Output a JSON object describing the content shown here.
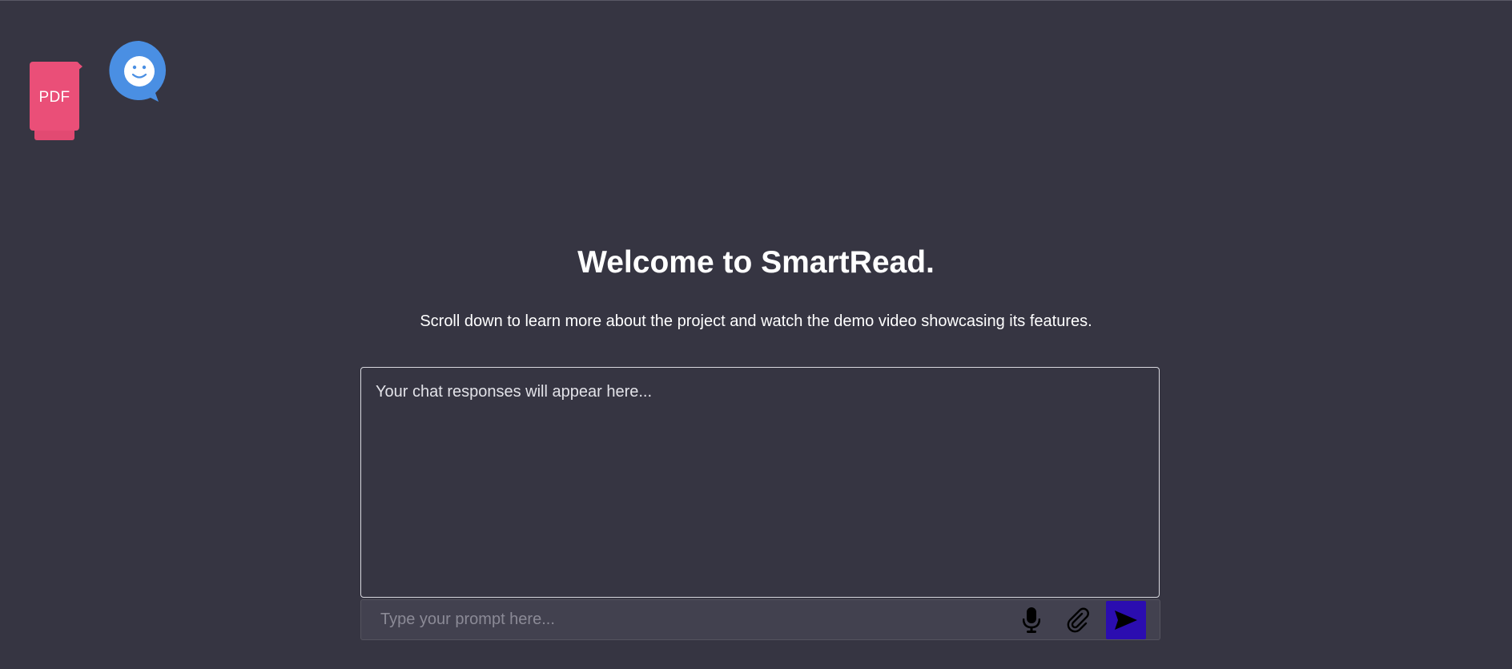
{
  "logo": {
    "pdf_label": "PDF",
    "pdf_icon": "pdf-document-icon",
    "chat_icon": "smiley-chat-bubble-icon",
    "colors": {
      "pdf": "#ea4f78",
      "bubble": "#4a8fe3"
    }
  },
  "hero": {
    "title": "Welcome to SmartRead.",
    "subtitle": "Scroll down to learn more about the project and watch the demo video showcasing its features."
  },
  "chat": {
    "response_placeholder": "Your chat responses will appear here..."
  },
  "prompt": {
    "placeholder": "Type your prompt here...",
    "value": "",
    "mic_icon": "microphone-icon",
    "attach_icon": "paperclip-icon",
    "send_icon": "send-arrow-icon",
    "send_color": "#2b0db0"
  },
  "theme": {
    "background": "#363542",
    "text": "#ffffff"
  }
}
